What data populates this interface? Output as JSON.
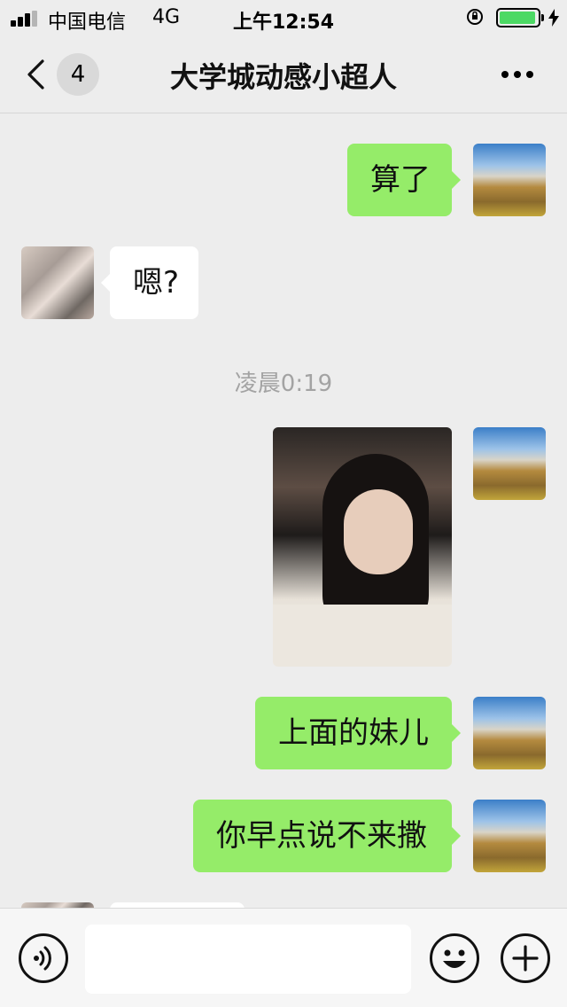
{
  "status_bar": {
    "carrier": "中国电信",
    "network": "4G",
    "time": "上午12:54",
    "signal_bars": 3,
    "battery_level": 0.95
  },
  "nav": {
    "unread_count": "4",
    "title": "大学城动感小超人"
  },
  "messages": {
    "m1": "算了",
    "m2": "嗯?",
    "timestamp": "凌晨0:19",
    "m4": "上面的妹儿",
    "m5": "你早点说不来撒"
  },
  "input_bar": {
    "placeholder": ""
  },
  "colors": {
    "sent_bubble": "#95ec69",
    "received_bubble": "#ffffff",
    "background": "#ededed"
  },
  "icons": [
    "back-chevron-icon",
    "more-icon",
    "voice-icon",
    "emoji-icon",
    "plus-icon",
    "rotation-lock-icon",
    "battery-icon",
    "signal-icon",
    "charging-icon"
  ]
}
